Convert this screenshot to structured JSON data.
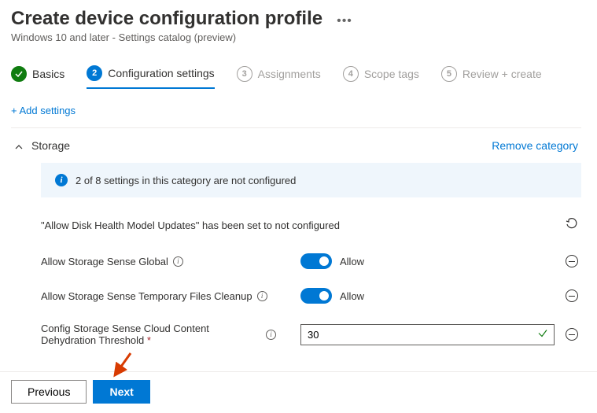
{
  "header": {
    "title": "Create device configuration profile",
    "subtitle": "Windows 10 and later - Settings catalog (preview)"
  },
  "steps": [
    {
      "num": "✓",
      "label": "Basics"
    },
    {
      "num": "2",
      "label": "Configuration settings"
    },
    {
      "num": "3",
      "label": "Assignments"
    },
    {
      "num": "4",
      "label": "Scope tags"
    },
    {
      "num": "5",
      "label": "Review + create"
    }
  ],
  "add_settings": "+ Add settings",
  "section": {
    "title": "Storage",
    "remove": "Remove category",
    "info": "2 of 8 settings in this category are not configured"
  },
  "settings": {
    "not_configured": "\"Allow Disk Health Model Updates\" has been set to not configured",
    "allow_global_label": "Allow Storage Sense Global",
    "allow_global_value": "Allow",
    "allow_temp_label": "Allow Storage Sense Temporary Files Cleanup",
    "allow_temp_value": "Allow",
    "dehydration_label": "Config Storage Sense Cloud Content Dehydration Threshold",
    "dehydration_value": "30"
  },
  "footer": {
    "previous": "Previous",
    "next": "Next"
  }
}
